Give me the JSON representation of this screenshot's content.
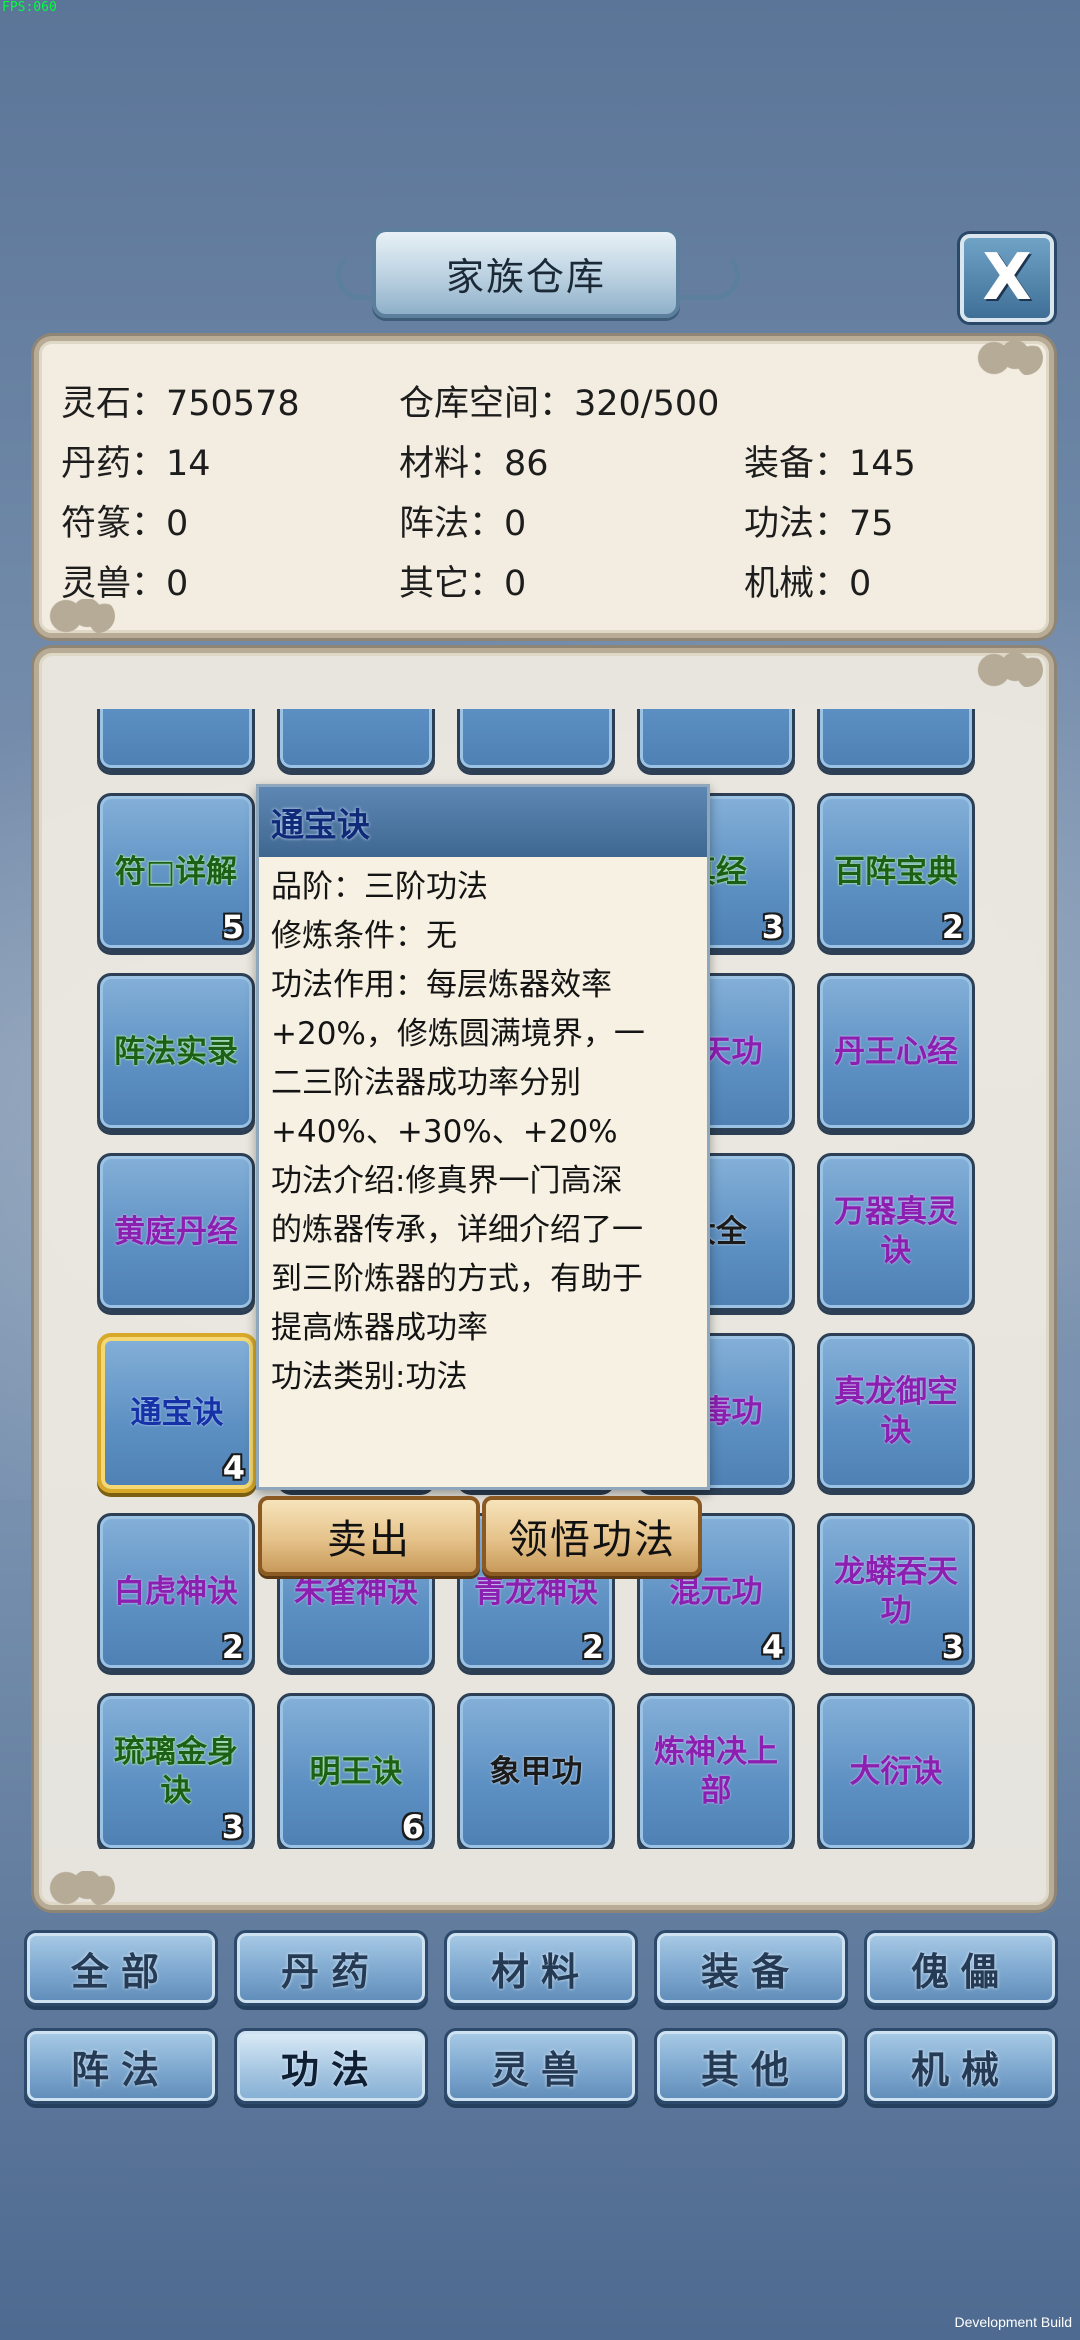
{
  "debug": {
    "fps": "FPS:060",
    "build": "Development Build"
  },
  "header": {
    "title": "家族仓库",
    "close": "X"
  },
  "stats": {
    "spirit_stone": "灵石：750578",
    "storage": "仓库空间：320/500",
    "pills": "丹药：14",
    "materials": "材料：86",
    "equipment": "装备：145",
    "talismans": "符篆：0",
    "formations": "阵法：0",
    "techniques": "功法：75",
    "beasts": "灵兽：0",
    "others": "其它：0",
    "machinery": "机械：0"
  },
  "grid": {
    "items": [
      {
        "name": "",
        "count": "",
        "color": "white"
      },
      {
        "name": "",
        "count": "",
        "color": "white"
      },
      {
        "name": "",
        "count": "",
        "color": "white"
      },
      {
        "name": "",
        "count": "",
        "color": "white"
      },
      {
        "name": "",
        "count": "",
        "color": "white"
      },
      {
        "name": "符□详解",
        "count": "5",
        "color": "green"
      },
      {
        "name": "",
        "count": "",
        "color": "white"
      },
      {
        "name": "",
        "count": "",
        "color": "white"
      },
      {
        "name": "真经",
        "count": "3",
        "color": "green"
      },
      {
        "name": "百阵宝典",
        "count": "2",
        "color": "green"
      },
      {
        "name": "阵法实录",
        "count": "",
        "color": "green"
      },
      {
        "name": "",
        "count": "",
        "color": "white"
      },
      {
        "name": "",
        "count": "",
        "color": "white"
      },
      {
        "name": "通天功",
        "count": "",
        "color": "purple"
      },
      {
        "name": "丹王心经",
        "count": "",
        "color": "purple"
      },
      {
        "name": "黄庭丹经",
        "count": "",
        "color": "purple"
      },
      {
        "name": "",
        "count": "",
        "color": "white"
      },
      {
        "name": "",
        "count": "",
        "color": "white"
      },
      {
        "name": "大全",
        "count": "",
        "color": "white"
      },
      {
        "name": "万器真灵诀",
        "count": "",
        "color": "purple"
      },
      {
        "name": "通宝诀",
        "count": "4",
        "color": "blue",
        "selected": true
      },
      {
        "name": "",
        "count": "",
        "color": "white"
      },
      {
        "name": "",
        "count": "",
        "color": "white"
      },
      {
        "name": "万毒功",
        "count": "",
        "color": "purple"
      },
      {
        "name": "真龙御空诀",
        "count": "",
        "color": "purple"
      },
      {
        "name": "白虎神诀",
        "count": "2",
        "color": "purple"
      },
      {
        "name": "朱雀神诀",
        "count": "",
        "color": "purple"
      },
      {
        "name": "青龙神诀",
        "count": "2",
        "color": "purple"
      },
      {
        "name": "混元功",
        "count": "4",
        "color": "purple"
      },
      {
        "name": "龙蟒吞天功",
        "count": "3",
        "color": "purple"
      },
      {
        "name": "琉璃金身诀",
        "count": "3",
        "color": "green"
      },
      {
        "name": "明王诀",
        "count": "6",
        "color": "green"
      },
      {
        "name": "象甲功",
        "count": "",
        "color": "white"
      },
      {
        "name": "炼神决上部",
        "count": "",
        "color": "purple"
      },
      {
        "name": "大衍诀",
        "count": "",
        "color": "purple"
      }
    ]
  },
  "tooltip": {
    "title": "通宝诀",
    "lines": [
      "品阶：三阶功法",
      "修炼条件：无",
      "功法作用：每层炼器效率",
      "+20%，修炼圆满境界，一",
      "二三阶法器成功率分别",
      "+40%、+30%、+20%",
      "功法介绍:修真界一门高深",
      "的炼器传承，详细介绍了一",
      "到三阶炼器的方式，有助于",
      "提高炼器成功率",
      "功法类别:功法"
    ],
    "sell": "卖出",
    "learn": "领悟功法"
  },
  "tabs": [
    {
      "label": "全部"
    },
    {
      "label": "丹药"
    },
    {
      "label": "材料"
    },
    {
      "label": "装备"
    },
    {
      "label": "傀儡"
    },
    {
      "label": "阵法"
    },
    {
      "label": "功法",
      "active": true
    },
    {
      "label": "灵兽"
    },
    {
      "label": "其他"
    },
    {
      "label": "机械"
    }
  ]
}
